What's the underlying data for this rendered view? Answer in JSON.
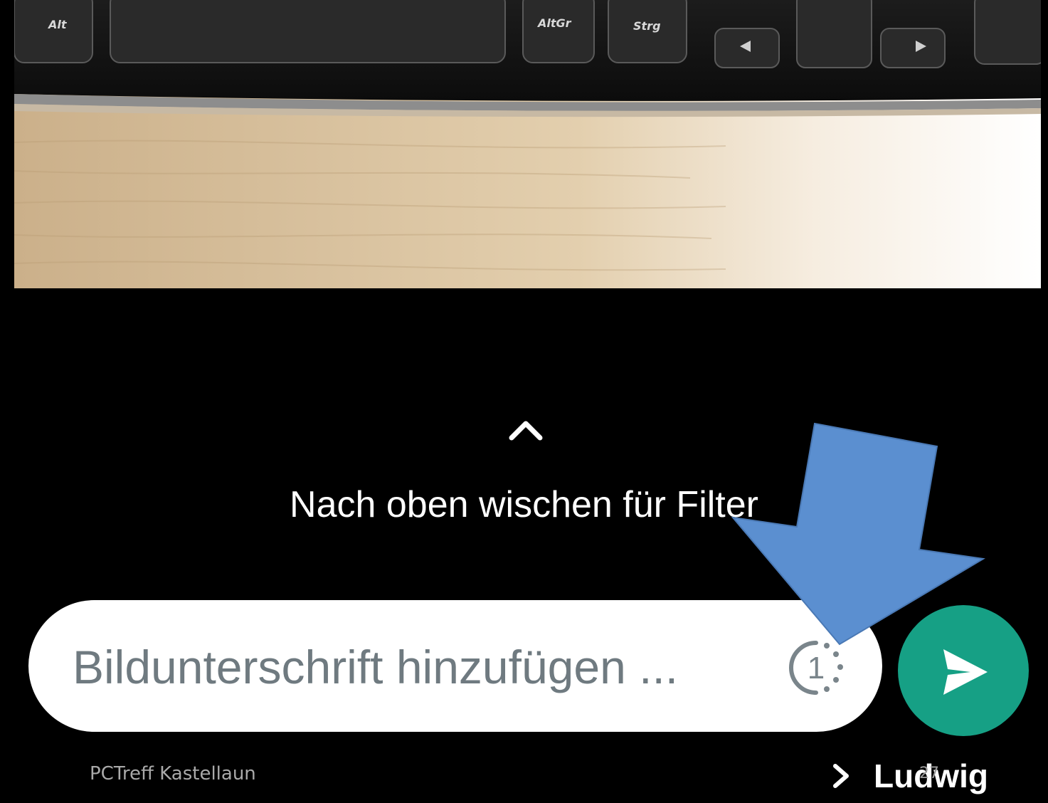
{
  "photo": {
    "keyboard_keys": [
      "Alt",
      "AltGr",
      "Strg"
    ],
    "icon": "keyboard-on-desk-photo"
  },
  "swipe": {
    "hint": "Nach oben wischen für Filter",
    "icon": "chevron-up-icon"
  },
  "caption": {
    "placeholder": "Bildunterschrift hinzufügen ...",
    "view_once_count": "1",
    "icon": "view-once-icon"
  },
  "send": {
    "icon": "send-icon",
    "color": "#16a085"
  },
  "recipient": {
    "name": "Ludwig",
    "icon": "chevron-right-icon"
  },
  "footer": {
    "left": "PCTreff Kastellaun",
    "slide_number": "27"
  },
  "annotation": {
    "icon": "blue-arrow-annotation",
    "color": "#5b8fd0"
  }
}
